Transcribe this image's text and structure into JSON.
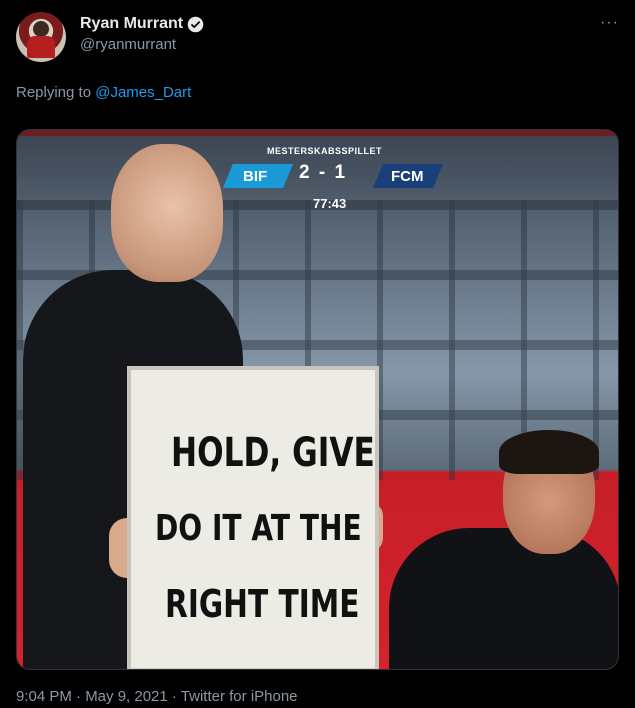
{
  "tweet": {
    "display_name": "Ryan Murrant",
    "handle": "@ryanmurrant",
    "more_label": "···",
    "reply_prefix": "Replying to",
    "reply_to": "@James_Dart",
    "timestamp": "9:04 PM · May 9, 2021 · Twitter for iPhone",
    "verified_icon": "verified-badge-icon"
  },
  "media": {
    "scoreboard": {
      "league": "MESTERSKABSSPILLET",
      "home": "BIF",
      "score": "2 - 1",
      "away": "FCM",
      "clock": "77:43"
    },
    "board_lines": [
      "HOLD, GIVE",
      "DO IT  AT THE",
      "RIGHT TIME"
    ]
  },
  "colors": {
    "link": "#1d9bf0",
    "muted": "#8b98a5",
    "background": "#000000"
  }
}
